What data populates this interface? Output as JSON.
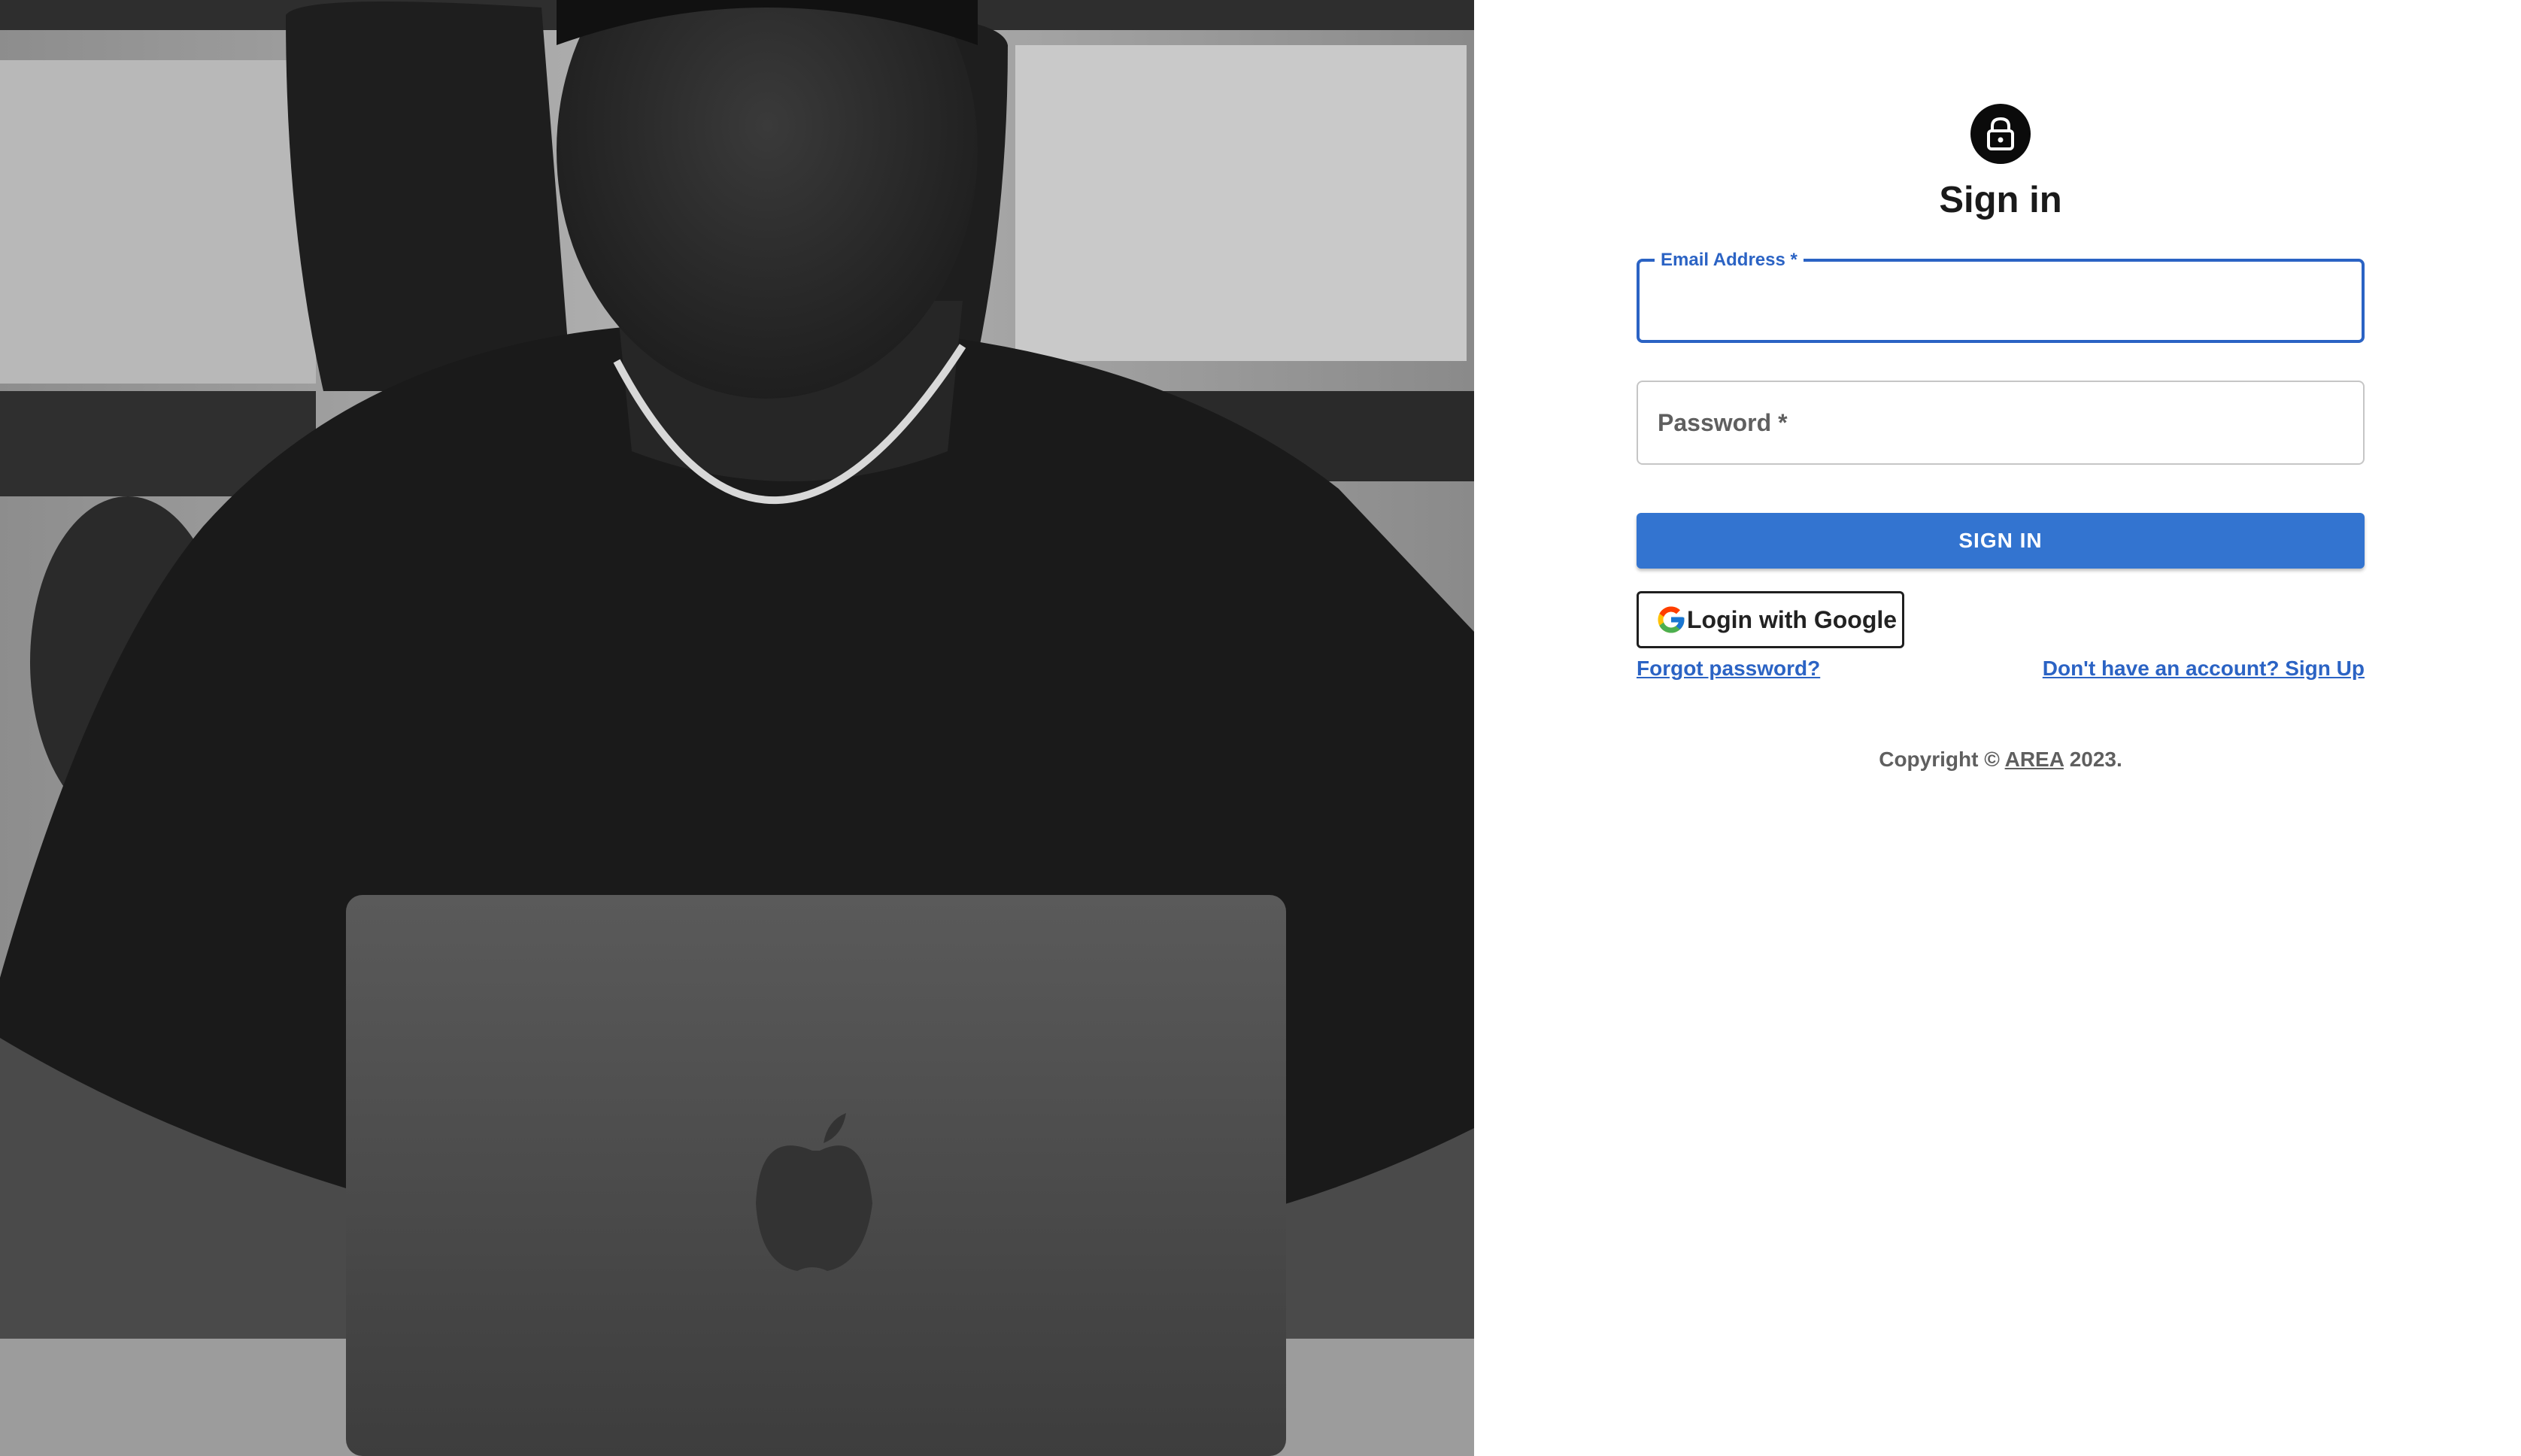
{
  "hero": {
    "icon": "person-with-laptop-photo"
  },
  "form": {
    "lock_icon": "lock-icon",
    "title": "Sign in",
    "email": {
      "label": "Email Address *",
      "value": "",
      "placeholder": ""
    },
    "password": {
      "label": "Password *",
      "value": "",
      "placeholder": ""
    },
    "submit_label": "SIGN IN",
    "google_label": "Login with Google",
    "forgot_link": "Forgot password?",
    "signup_link": "Don't have an account? Sign Up"
  },
  "footer": {
    "prefix": "Copyright ©",
    "brand": "AREA",
    "suffix": "2023."
  },
  "colors": {
    "primary": "#3374d0",
    "focus_border": "#2b63c4",
    "avatar_bg": "#0b0b0b"
  }
}
